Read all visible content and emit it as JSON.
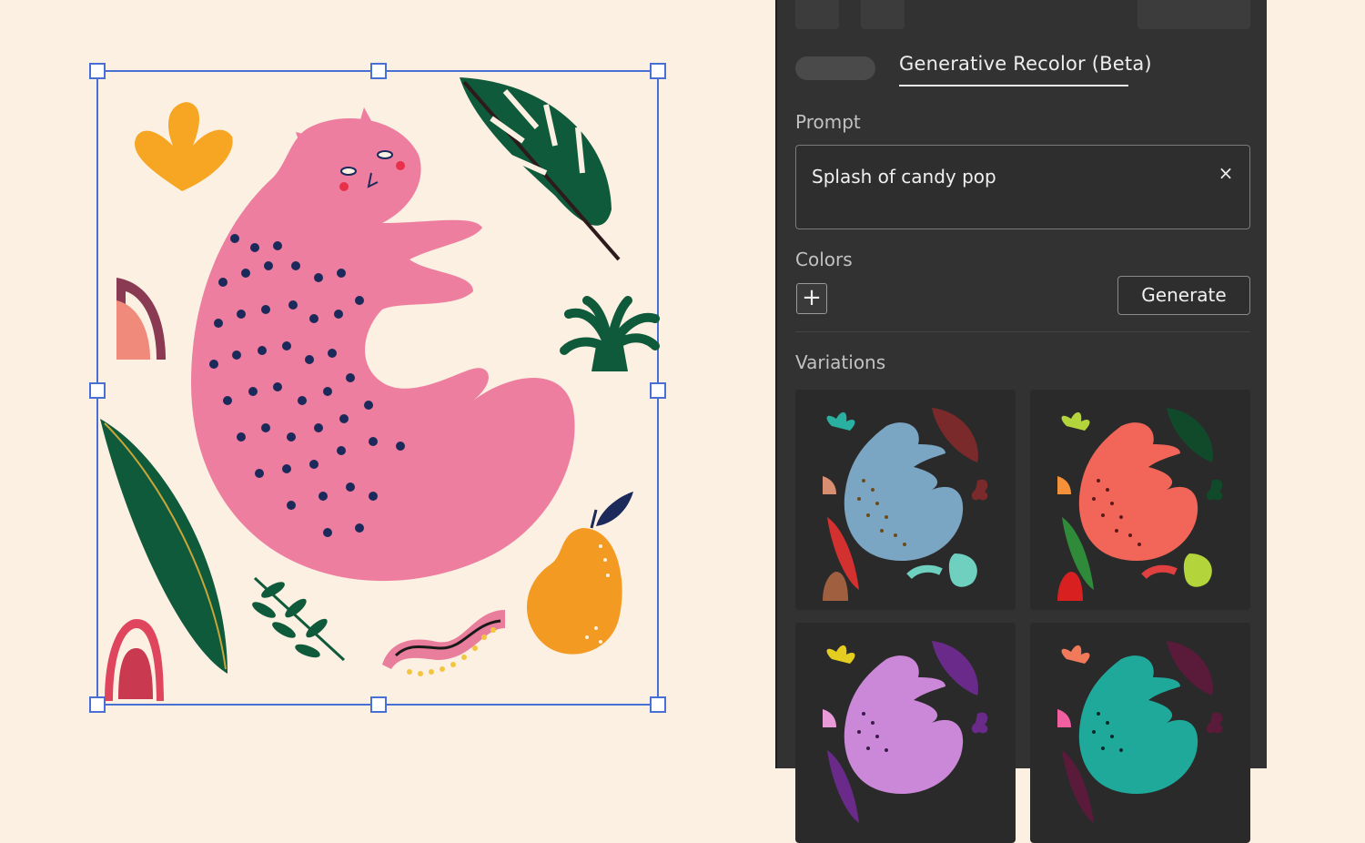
{
  "panel": {
    "tab_title": "Generative Recolor (Beta)",
    "prompt_label": "Prompt",
    "prompt_value": "Splash of candy pop",
    "clear_glyph": "×",
    "colors_label": "Colors",
    "add_color_glyph": "+",
    "generate_label": "Generate",
    "variations_label": "Variations"
  },
  "icons": {
    "clear": "close-icon",
    "add": "plus-icon"
  },
  "colors": {
    "selection": "#4a6fd4",
    "panel_bg": "#323232",
    "canvas_bg": "#fcf0e3",
    "cat_original": "#ee7e9f",
    "cat_blue": "#7aa6c4",
    "cat_red": "#f26659",
    "cat_purple": "#cc88d8",
    "cat_teal": "#1fa99a"
  }
}
